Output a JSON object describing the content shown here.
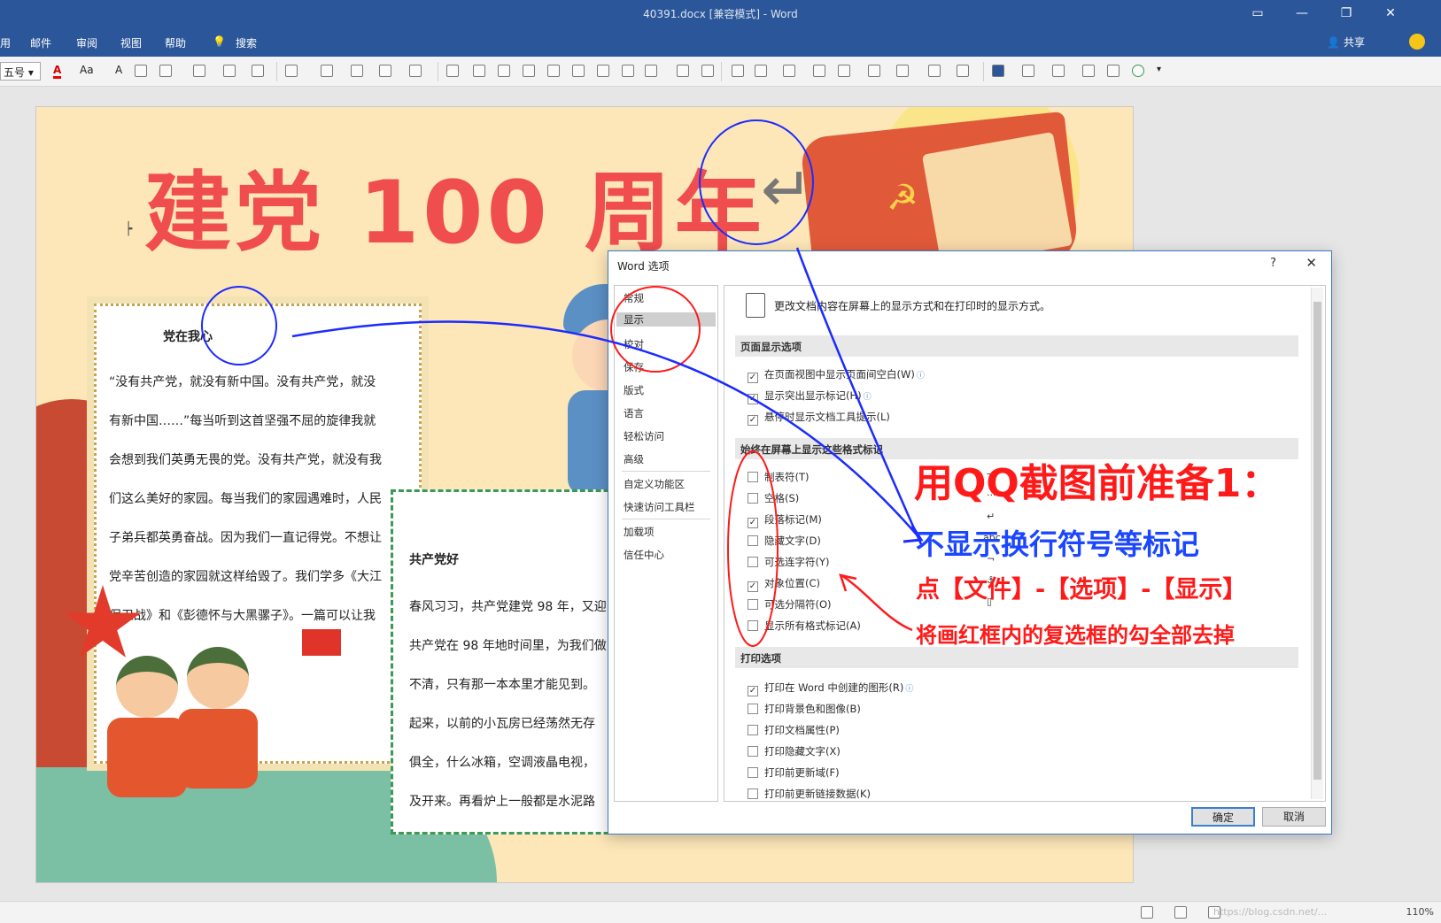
{
  "window": {
    "title": "40391.docx [兼容模式]  -  Word"
  },
  "ribbon": {
    "tabs": [
      "用",
      "邮件",
      "审阅",
      "视图",
      "帮助",
      "搜索"
    ],
    "share_label": "共享"
  },
  "toolbar": {
    "font_size": "五号",
    "font_color_label": "A",
    "case_label": "Aa",
    "clear_label": "A"
  },
  "document": {
    "headline": "建党 100 周年",
    "card1": {
      "title": "党在我心",
      "lines": [
        "“没有共产党，就没有新中国。没有共产党，就没",
        "有新中国……”每当听到这首坚强不屈的旋律我就",
        "会想到我们英勇无畏的党。没有共产党，就没有我",
        "们这么美好的家园。每当我们的家园遇难时，人民",
        "子弟兵都英勇奋战。因为我们一直记得党。不想让",
        "党辛苦创造的家园就这样给毁了。我们学多《大江",
        "保卫战》和《彭德怀与大黑骡子》。一篇可以让我"
      ]
    },
    "card2": {
      "title": "共产党好",
      "lines": [
        "春风习习，共产党建党 98 年，又迎",
        "共产党在 98 年地时间里，为我们做",
        "不清，只有那一本本里才能见到。",
        "起来，以前的小瓦房已经荡然无存",
        "俱全，什么冰箱，空调液晶电视，",
        "及开来。再看炉上一般都是水泥路"
      ]
    }
  },
  "dialog": {
    "title": "Word 选项",
    "help": "?",
    "close": "✕",
    "nav": [
      {
        "label": "常规"
      },
      {
        "label": "显示",
        "selected": true
      },
      {
        "label": "校对"
      },
      {
        "label": "保存"
      },
      {
        "label": "版式"
      },
      {
        "label": "语言"
      },
      {
        "label": "轻松访问"
      },
      {
        "label": "高级"
      },
      {
        "label": "自定义功能区"
      },
      {
        "label": "快速访问工具栏"
      },
      {
        "label": "加载项"
      },
      {
        "label": "信任中心"
      }
    ],
    "intro": "更改文档内容在屏幕上的显示方式和在打印时的显示方式。",
    "section_page": "页面显示选项",
    "page_options": [
      {
        "label": "在页面视图中显示页面间空白(W)",
        "checked": true,
        "info": true
      },
      {
        "label": "显示突出显示标记(H)",
        "checked": true,
        "info": true
      },
      {
        "label": "悬停时显示文档工具提示(L)",
        "checked": true,
        "info": false
      }
    ],
    "section_marks": "始终在屏幕上显示这些格式标记",
    "mark_options": [
      {
        "label": "制表符(T)",
        "checked": false,
        "symbol": "→"
      },
      {
        "label": "空格(S)",
        "checked": false,
        "symbol": "···"
      },
      {
        "label": "段落标记(M)",
        "checked": true,
        "symbol": "↵"
      },
      {
        "label": "隐藏文字(D)",
        "checked": false,
        "symbol": "abc"
      },
      {
        "label": "可选连字符(Y)",
        "checked": false,
        "symbol": "¬"
      },
      {
        "label": "对象位置(C)",
        "checked": true,
        "symbol": "⚓"
      },
      {
        "label": "可选分隔符(O)",
        "checked": false,
        "symbol": "▯"
      },
      {
        "label": "显示所有格式标记(A)",
        "checked": false,
        "symbol": ""
      }
    ],
    "section_print": "打印选项",
    "print_options": [
      {
        "label": "打印在 Word 中创建的图形(R)",
        "checked": true,
        "info": true
      },
      {
        "label": "打印背景色和图像(B)",
        "checked": false
      },
      {
        "label": "打印文档属性(P)",
        "checked": false
      },
      {
        "label": "打印隐藏文字(X)",
        "checked": false
      },
      {
        "label": "打印前更新域(F)",
        "checked": false
      },
      {
        "label": "打印前更新链接数据(K)",
        "checked": false
      }
    ],
    "ok_label": "确定",
    "cancel_label": "取消"
  },
  "annotations": {
    "line1": "用QQ截图前准备1：",
    "line2": "不显示换行符号等标记",
    "line3": "点【文件】-【选项】-【显示】",
    "line4": "将画红框内的复选框的勾全部去掉"
  },
  "statusbar": {
    "watermark": "https://blog.csdn.net/...",
    "zoom": "110%"
  },
  "colors": {
    "ribbon": "#2b579a",
    "headline": "#f04e4e",
    "annot_red": "#ff1a1a",
    "annot_blue": "#1b46ff"
  }
}
